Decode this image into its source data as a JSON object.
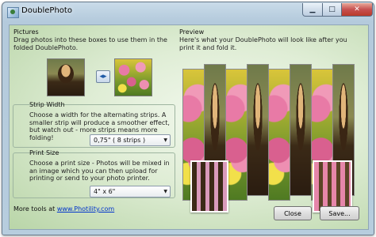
{
  "window": {
    "title": "DoublePhoto"
  },
  "title_buttons": {
    "minimize": "▁",
    "maximize": "□",
    "close": "✕"
  },
  "pictures": {
    "heading": "Pictures",
    "description": "Drag photos into these boxes to use them in the folded DoublePhoto.",
    "swap_symbol": "◂▸"
  },
  "strip_width": {
    "heading": "Strip Width",
    "description": "Choose a width for the alternating strips. A smaller strip will produce a smoother effect, but watch out - more strips means more folding!",
    "selected": "0,75\" ( 8 strips )"
  },
  "print_size": {
    "heading": "Print Size",
    "description": "Choose a print size - Photos will be mixed in an image which you can then upload for printing or send to your photo printer.",
    "selected": "4\" x 6\""
  },
  "preview": {
    "heading": "Preview",
    "description": "Here's what your DoublePhoto will look like after you print it and fold it."
  },
  "footer": {
    "more_tools_prefix": "More tools at",
    "link_text": "www.Photility.com",
    "close_label": "Close",
    "save_label": "Save..."
  },
  "colors": {
    "accent_link": "#0033cc",
    "close_red": "#c75050"
  }
}
